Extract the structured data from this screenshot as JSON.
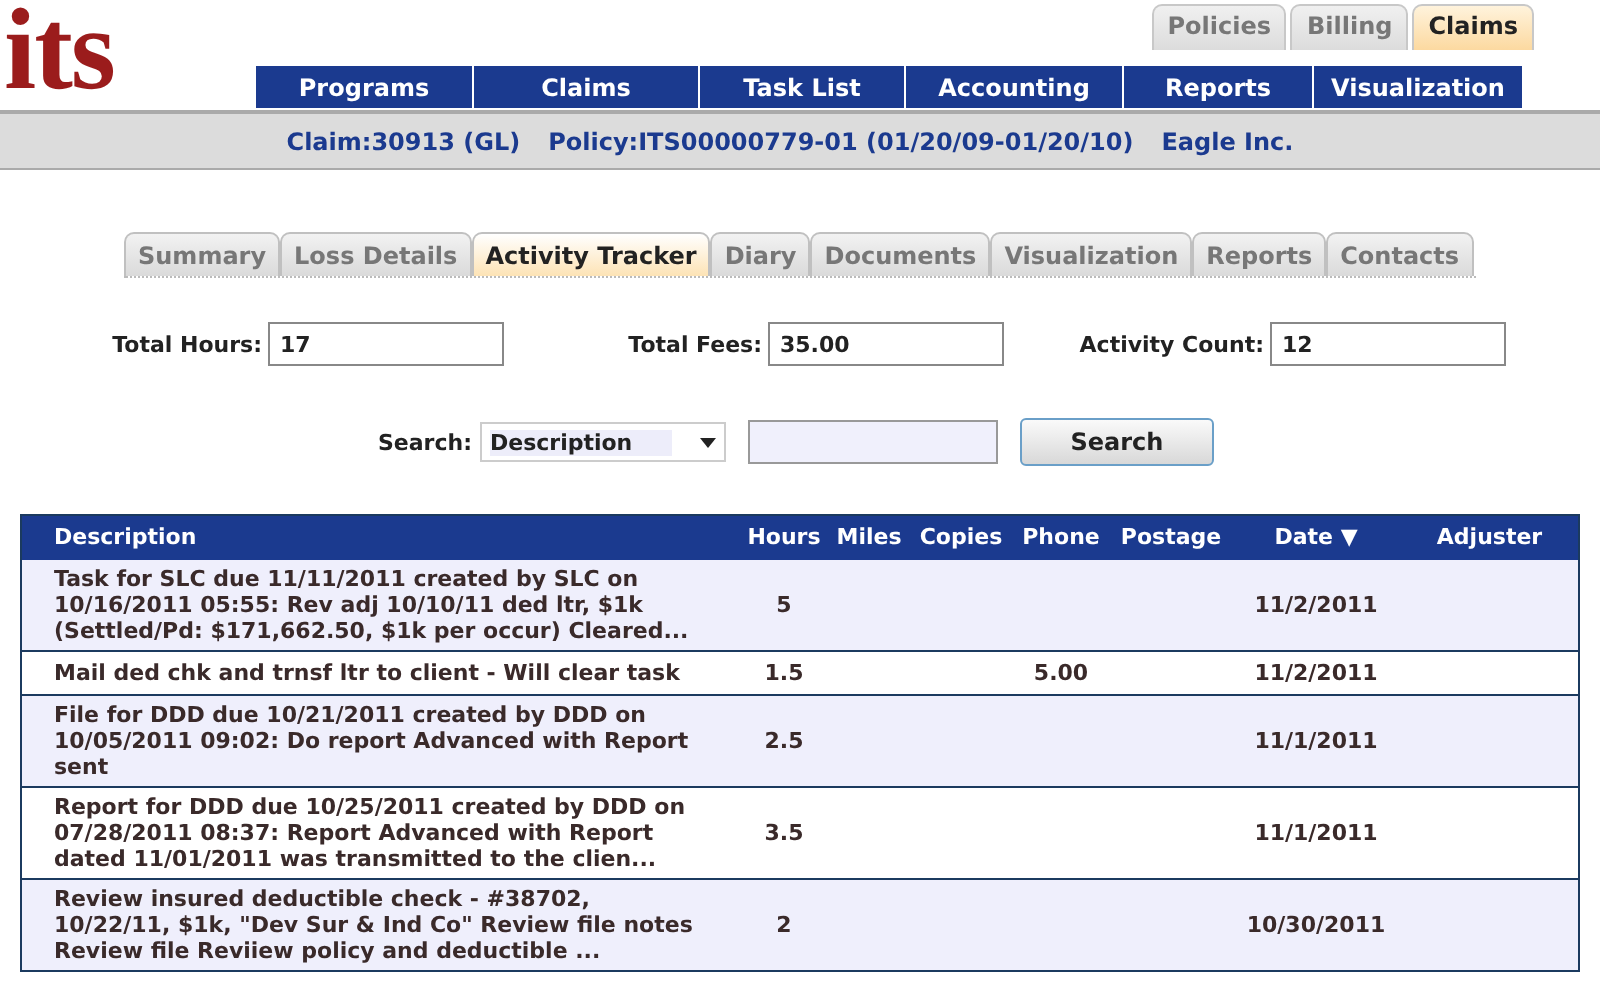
{
  "logo": "its",
  "top_tabs": [
    {
      "label": "Policies",
      "selected": false
    },
    {
      "label": "Billing",
      "selected": false
    },
    {
      "label": "Claims",
      "selected": true
    }
  ],
  "nav": [
    "Programs",
    "Claims",
    "Task List",
    "Accounting",
    "Reports",
    "Visualization"
  ],
  "claim_bar": {
    "claim": "Claim:30913 (GL)",
    "policy": "Policy:ITS00000779-01 (01/20/09-01/20/10)",
    "insured": "Eagle Inc."
  },
  "tabs": [
    {
      "label": "Summary",
      "selected": false
    },
    {
      "label": "Loss Details",
      "selected": false
    },
    {
      "label": "Activity Tracker",
      "selected": true
    },
    {
      "label": "Diary",
      "selected": false
    },
    {
      "label": "Documents",
      "selected": false
    },
    {
      "label": "Visualization",
      "selected": false
    },
    {
      "label": "Reports",
      "selected": false
    },
    {
      "label": "Contacts",
      "selected": false
    }
  ],
  "totals": [
    {
      "label": "Total Hours:",
      "value": "17"
    },
    {
      "label": "Total Fees:",
      "value": "35.00"
    },
    {
      "label": "Activity Count:",
      "value": "12"
    }
  ],
  "search": {
    "label": "Search:",
    "field": "Description",
    "button": "Search"
  },
  "table": {
    "columns": [
      "Description",
      "Hours",
      "Miles",
      "Copies",
      "Phone",
      "Postage",
      "Date",
      "Adjuster"
    ],
    "sort_indicator": "▼",
    "rows": [
      [
        "Task for SLC due 11/11/2011 created by SLC on 10/16/2011 05:55: Rev adj 10/10/11 ded ltr, $1k (Settled/Pd: $171,662.50, $1k per occur) Cleared...",
        "5",
        "",
        "",
        "",
        "",
        "11/2/2011",
        ""
      ],
      [
        "Mail ded chk and trnsf ltr to client - Will clear task",
        "1.5",
        "",
        "",
        "5.00",
        "",
        "11/2/2011",
        ""
      ],
      [
        "File for DDD due 10/21/2011 created by DDD on 10/05/2011 09:02: Do report Advanced with Report sent",
        "2.5",
        "",
        "",
        "",
        "",
        "11/1/2011",
        ""
      ],
      [
        "Report for DDD due 10/25/2011 created by DDD on 07/28/2011 08:37: Report Advanced with Report dated 11/01/2011 was transmitted to the clien...",
        "3.5",
        "",
        "",
        "",
        "",
        "11/1/2011",
        ""
      ],
      [
        "Review insured deductible check - #38702, 10/22/11, $1k, \"Dev Sur & Ind Co\" Review file notes Review file Reviiew policy and deductible ...",
        "2",
        "",
        "",
        "",
        "",
        "10/30/2011",
        ""
      ]
    ]
  }
}
